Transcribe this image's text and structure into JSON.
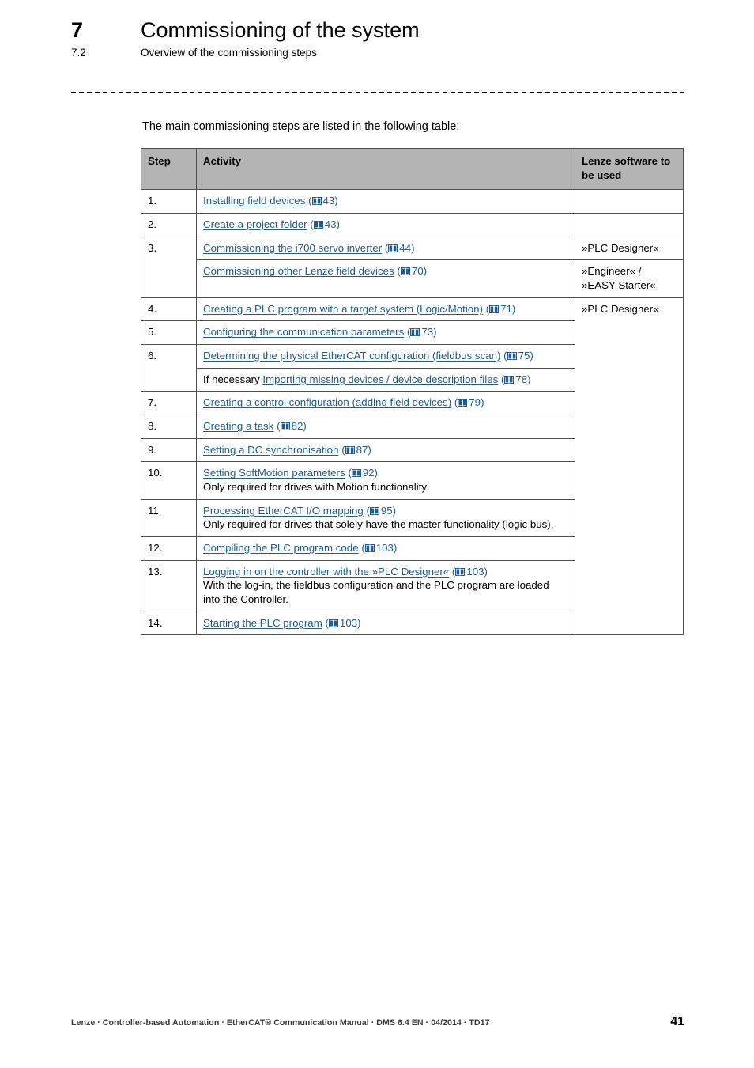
{
  "header": {
    "chapter_number": "7",
    "chapter_title": "Commissioning of the system",
    "section_number": "7.2",
    "section_title": "Overview of the commissioning steps"
  },
  "intro": {
    "text": "The main commissioning steps are listed in the following table:"
  },
  "table": {
    "columns": [
      "Step",
      "Activity",
      "Lenze software to be used"
    ],
    "rows": [
      {
        "step": "1.",
        "lines": [
          {
            "prefix": "",
            "link": "Installing field devices",
            "page": "43",
            "note": ""
          }
        ],
        "software": ""
      },
      {
        "step": "2.",
        "lines": [
          {
            "prefix": "",
            "link": "Create a project folder",
            "page": "43",
            "note": ""
          }
        ],
        "software": ""
      },
      {
        "step": "3.",
        "lines": [
          {
            "prefix": "",
            "link": "Commissioning the i700 servo inverter",
            "page": "44",
            "note": ""
          }
        ],
        "software": "»PLC Designer«"
      },
      {
        "step": "",
        "lines": [
          {
            "prefix": "",
            "link": "Commissioning other Lenze field devices",
            "page": "70",
            "note": ""
          }
        ],
        "software": "»Engineer« /\n»EASY Starter«"
      },
      {
        "step": "4.",
        "lines": [
          {
            "prefix": "",
            "link": "Creating a PLC program with a target system (Logic/Motion)",
            "page": "71",
            "note": ""
          }
        ],
        "software": "»PLC Designer«"
      },
      {
        "step": "5.",
        "lines": [
          {
            "prefix": "",
            "link": "Configuring the communication parameters",
            "page": "73",
            "note": ""
          }
        ],
        "software": ""
      },
      {
        "step": "6.",
        "lines": [
          {
            "prefix": "",
            "link": "Determining the physical EtherCAT configuration (fieldbus scan)",
            "page": "75",
            "note": ""
          }
        ],
        "software": ""
      },
      {
        "step": "",
        "lines": [
          {
            "prefix": "If necessary ",
            "link": "Importing missing devices / device description files",
            "page": "78",
            "note": ""
          }
        ],
        "software": ""
      },
      {
        "step": "7.",
        "lines": [
          {
            "prefix": "",
            "link": "Creating a control configuration (adding field devices)",
            "page": "79",
            "note": ""
          }
        ],
        "software": ""
      },
      {
        "step": "8.",
        "lines": [
          {
            "prefix": "",
            "link": "Creating a task",
            "page": "82",
            "note": ""
          }
        ],
        "software": ""
      },
      {
        "step": "9.",
        "lines": [
          {
            "prefix": "",
            "link": "Setting a DC synchronisation",
            "page": "87",
            "note": ""
          }
        ],
        "software": ""
      },
      {
        "step": "10.",
        "lines": [
          {
            "prefix": "",
            "link": "Setting SoftMotion parameters",
            "page": "92",
            "note": "Only required for drives with Motion functionality."
          }
        ],
        "software": ""
      },
      {
        "step": "11.",
        "lines": [
          {
            "prefix": "",
            "link": "Processing EtherCAT I/O mapping",
            "page": "95",
            "note": "Only required for drives that solely have the master functionality (logic bus)."
          }
        ],
        "software": ""
      },
      {
        "step": "12.",
        "lines": [
          {
            "prefix": "",
            "link": "Compiling the PLC program code",
            "page": "103",
            "note": ""
          }
        ],
        "software": ""
      },
      {
        "step": "13.",
        "lines": [
          {
            "prefix": "",
            "link": "Logging in on the controller with the »PLC Designer«",
            "page": "103",
            "note": "With the log-in, the fieldbus configuration and the PLC program are loaded into the Controller."
          }
        ],
        "software": ""
      },
      {
        "step": "14.",
        "lines": [
          {
            "prefix": "",
            "link": "Starting the PLC program",
            "page": "103",
            "note": ""
          }
        ],
        "software": ""
      }
    ]
  },
  "footer": {
    "text": "Lenze · Controller-based Automation · EtherCAT® Communication Manual · DMS 6.4 EN · 04/2014 · TD17",
    "page_number": "41"
  },
  "icons": {
    "book": "book-icon"
  },
  "colors": {
    "link": "#1f5b96",
    "header_fill": "#b4b4b4",
    "border": "#4d4d4d",
    "text": "#000000"
  }
}
